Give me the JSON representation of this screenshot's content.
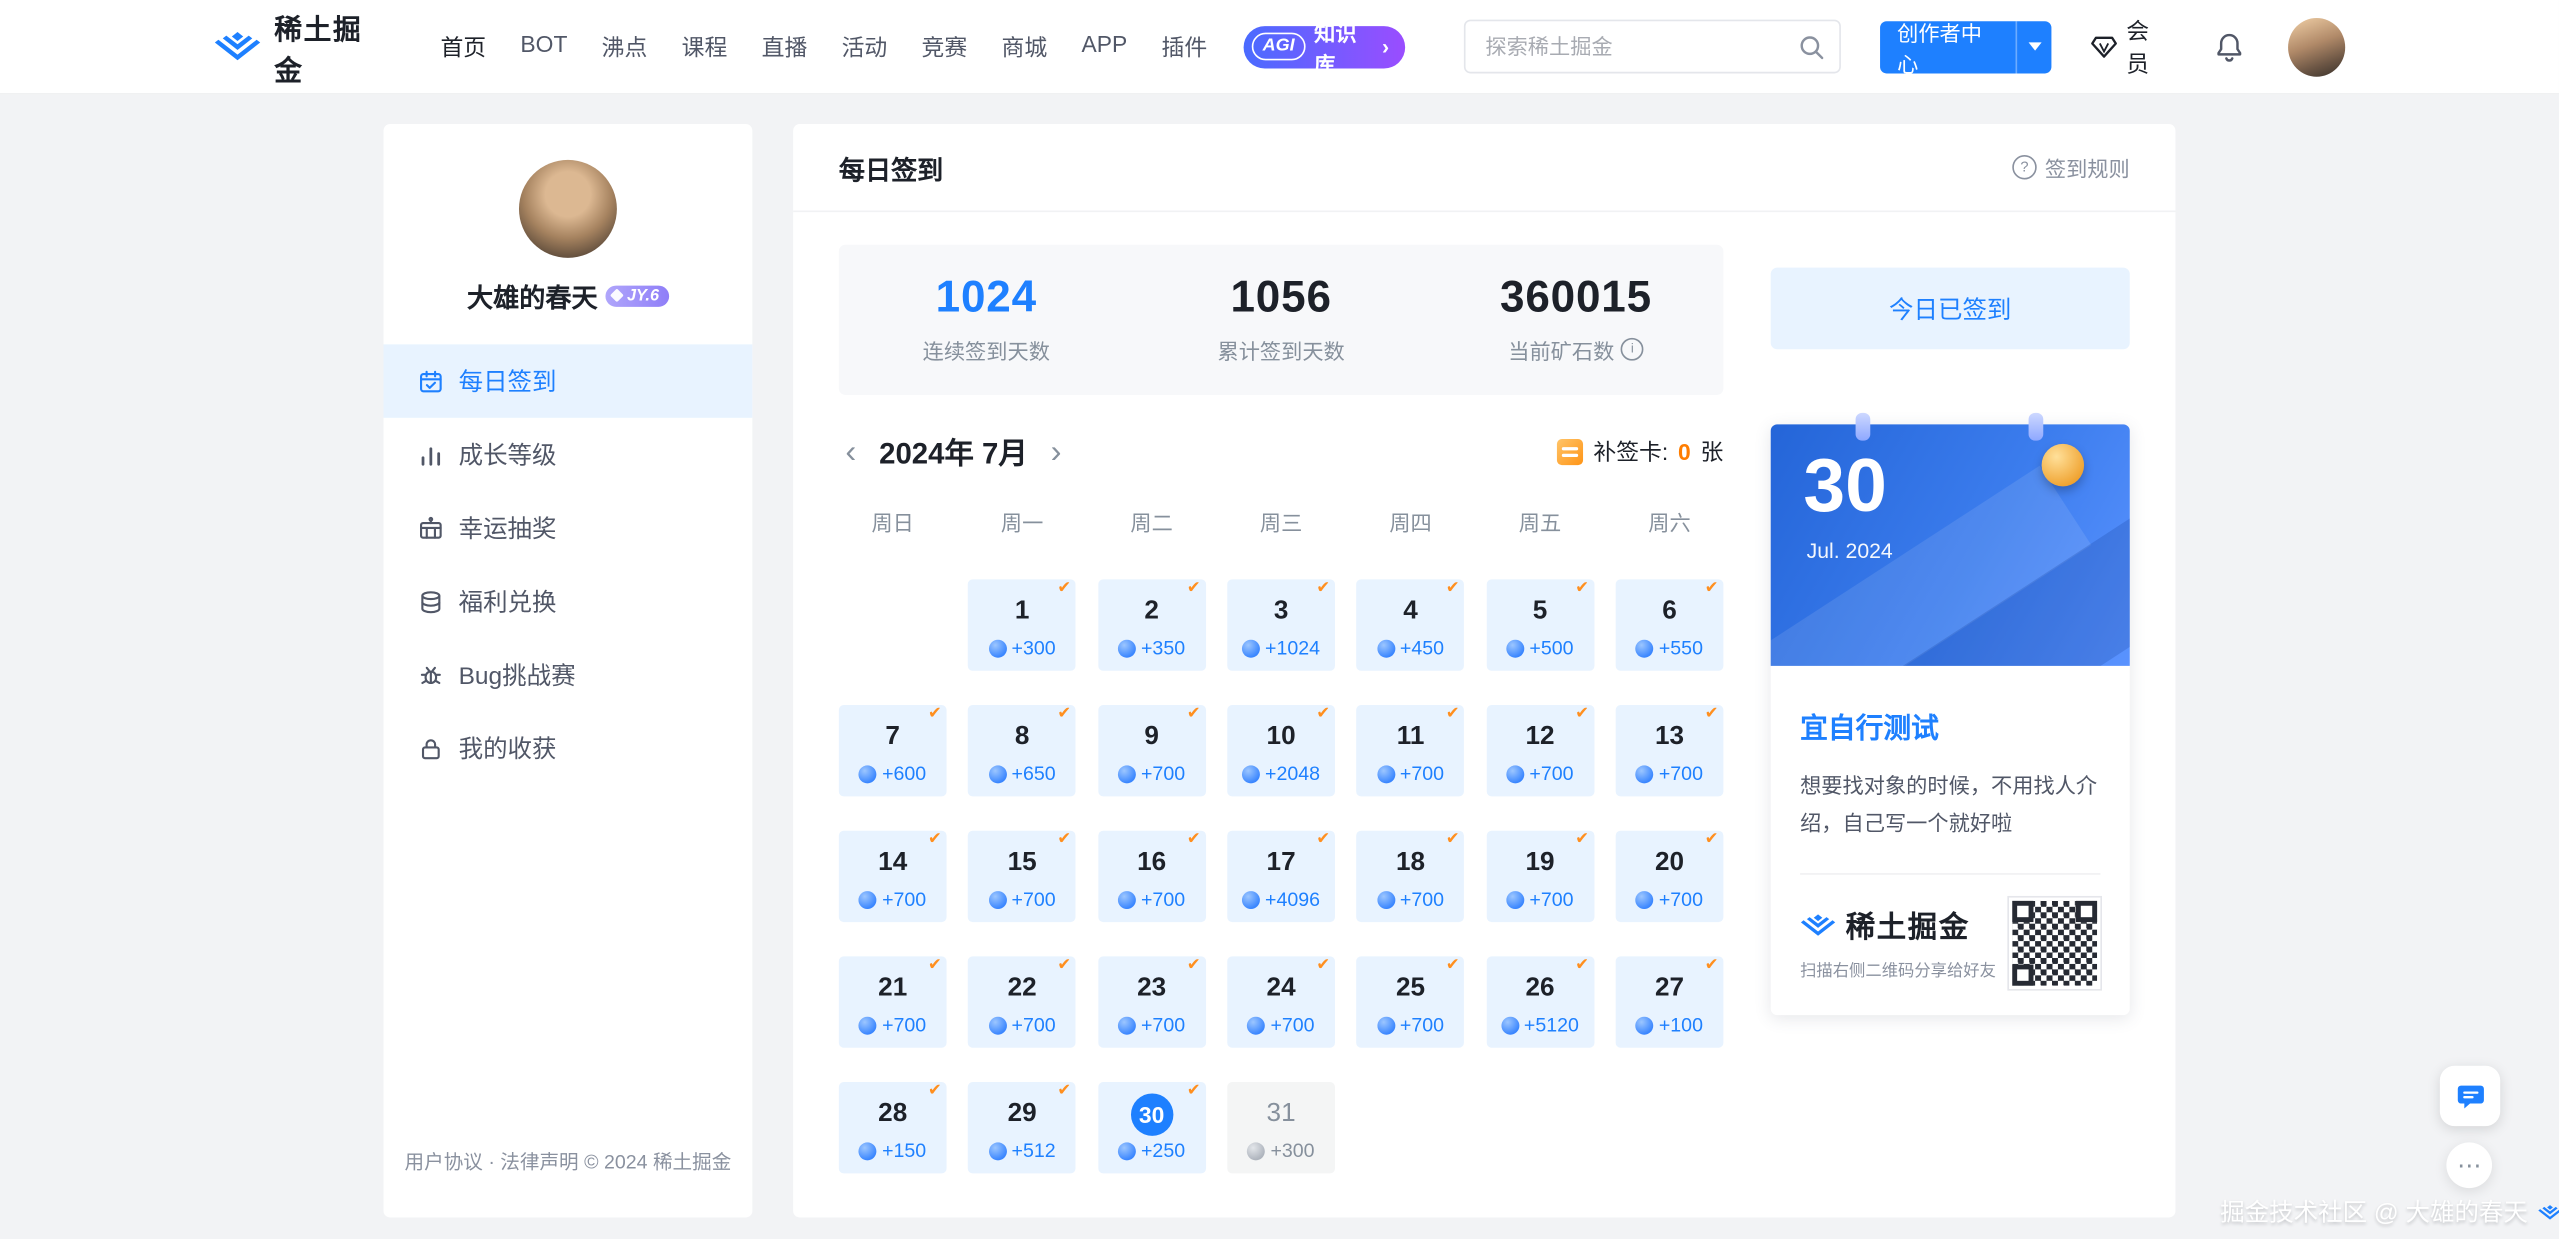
{
  "glyphs": {
    "question": "?",
    "info": "i",
    "prev": "‹",
    "next": "›",
    "check": "✔",
    "dots": "⋯",
    "agi_arrow": "›"
  },
  "colors": {
    "accent": "#1e80ff",
    "light_blue": "#e8f3ff",
    "check_orange": "#ff8f1f",
    "makeup_orange": "#ff7d00",
    "background": "#f2f3f5"
  },
  "navbar": {
    "brand": "稀土掘金",
    "items": [
      "首页",
      "BOT",
      "沸点",
      "课程",
      "直播",
      "活动",
      "竞赛",
      "商城",
      "APP",
      "插件"
    ],
    "agi": {
      "tag": "AGI",
      "label": "知识库"
    },
    "search_placeholder": "探索稀土掘金",
    "creator_center": "创作者中心",
    "member_label": "会员"
  },
  "sidebar": {
    "username": "大雄的春天",
    "level_badge": "JY.6",
    "menu": [
      {
        "label": "每日签到",
        "active": true
      },
      {
        "label": "成长等级",
        "active": false
      },
      {
        "label": "幸运抽奖",
        "active": false
      },
      {
        "label": "福利兑换",
        "active": false
      },
      {
        "label": "Bug挑战赛",
        "active": false
      },
      {
        "label": "我的收获",
        "active": false
      }
    ],
    "footer": "用户协议 · 法律声明 © 2024 稀土掘金"
  },
  "main": {
    "title": "每日签到",
    "rules_label": "签到规则",
    "stats": [
      {
        "value": "1024",
        "label": "连续签到天数",
        "accent": true
      },
      {
        "value": "1056",
        "label": "累计签到天数"
      },
      {
        "value": "360015",
        "label": "当前矿石数",
        "info": true
      }
    ],
    "calendar": {
      "month": "2024年 7月",
      "makeup_label": "补签卡:",
      "makeup_count": "0",
      "makeup_unit": "张",
      "weekdays": [
        "周日",
        "周一",
        "周二",
        "周三",
        "周四",
        "周五",
        "周六"
      ],
      "start_offset": 1,
      "days": [
        {
          "d": "1",
          "b": "+300",
          "s": "signed"
        },
        {
          "d": "2",
          "b": "+350",
          "s": "signed"
        },
        {
          "d": "3",
          "b": "+1024",
          "s": "signed"
        },
        {
          "d": "4",
          "b": "+450",
          "s": "signed"
        },
        {
          "d": "5",
          "b": "+500",
          "s": "signed"
        },
        {
          "d": "6",
          "b": "+550",
          "s": "signed"
        },
        {
          "d": "7",
          "b": "+600",
          "s": "signed"
        },
        {
          "d": "8",
          "b": "+650",
          "s": "signed"
        },
        {
          "d": "9",
          "b": "+700",
          "s": "signed"
        },
        {
          "d": "10",
          "b": "+2048",
          "s": "signed"
        },
        {
          "d": "11",
          "b": "+700",
          "s": "signed"
        },
        {
          "d": "12",
          "b": "+700",
          "s": "signed"
        },
        {
          "d": "13",
          "b": "+700",
          "s": "signed"
        },
        {
          "d": "14",
          "b": "+700",
          "s": "signed"
        },
        {
          "d": "15",
          "b": "+700",
          "s": "signed"
        },
        {
          "d": "16",
          "b": "+700",
          "s": "signed"
        },
        {
          "d": "17",
          "b": "+4096",
          "s": "signed"
        },
        {
          "d": "18",
          "b": "+700",
          "s": "signed"
        },
        {
          "d": "19",
          "b": "+700",
          "s": "signed"
        },
        {
          "d": "20",
          "b": "+700",
          "s": "signed"
        },
        {
          "d": "21",
          "b": "+700",
          "s": "signed"
        },
        {
          "d": "22",
          "b": "+700",
          "s": "signed"
        },
        {
          "d": "23",
          "b": "+700",
          "s": "signed"
        },
        {
          "d": "24",
          "b": "+700",
          "s": "signed"
        },
        {
          "d": "25",
          "b": "+700",
          "s": "signed"
        },
        {
          "d": "26",
          "b": "+5120",
          "s": "signed"
        },
        {
          "d": "27",
          "b": "+100",
          "s": "signed"
        },
        {
          "d": "28",
          "b": "+150",
          "s": "signed"
        },
        {
          "d": "29",
          "b": "+512",
          "s": "signed"
        },
        {
          "d": "30",
          "b": "+250",
          "s": "today"
        },
        {
          "d": "31",
          "b": "+300",
          "s": "future"
        }
      ]
    }
  },
  "aside": {
    "signed_button": "今日已签到",
    "promo": {
      "day": "30",
      "date": "Jul. 2024",
      "title": "宜自行测试",
      "desc": "想要找对象的时候，不用找人介绍，自己写一个就好啦",
      "brand": "稀土掘金",
      "scan_tip": "扫描右侧二维码分享给好友"
    }
  },
  "floating": {
    "watermark": "掘金技术社区 @ 大雄的春天"
  }
}
